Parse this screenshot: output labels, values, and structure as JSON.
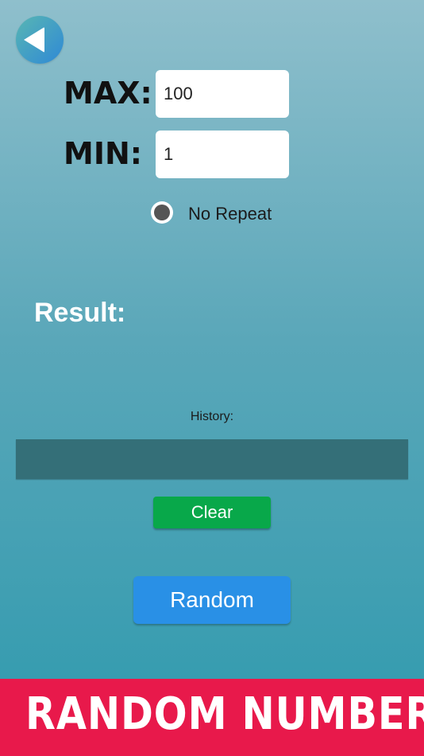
{
  "header": {
    "back_icon": "back-arrow-icon",
    "max_label": "MAX:",
    "min_label": "MIN:"
  },
  "inputs": {
    "max_value": "100",
    "min_value": "1"
  },
  "options": {
    "no_repeat_label": "No Repeat",
    "no_repeat_selected": true
  },
  "result": {
    "label": "Result:",
    "value": ""
  },
  "history": {
    "label": "History:",
    "items": []
  },
  "buttons": {
    "clear_label": "Clear",
    "random_label": "Random"
  },
  "banner": {
    "text": "RANDOM NUMBER"
  },
  "colors": {
    "banner": "#e8194b",
    "random_button": "#2990e6",
    "clear_button": "#08a84a",
    "history_box": "#346f78"
  }
}
